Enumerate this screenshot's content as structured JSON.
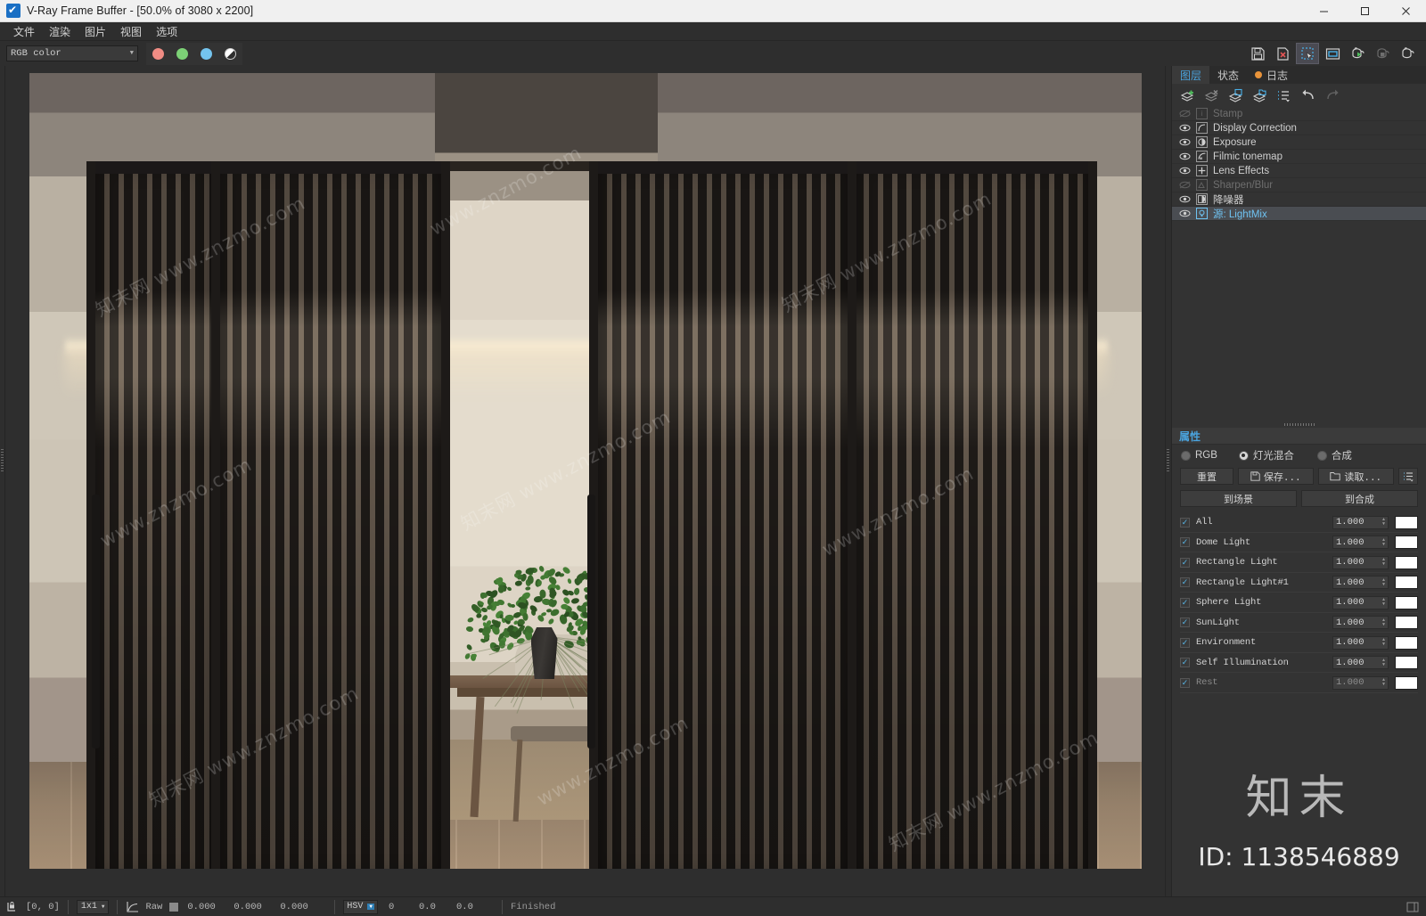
{
  "window": {
    "title": "V-Ray Frame Buffer - [50.0% of 3080 x 2200]",
    "minimize": "—",
    "maximize": "▢",
    "close": "✕"
  },
  "menubar": {
    "items": [
      "文件",
      "渲染",
      "图片",
      "视图",
      "选项"
    ]
  },
  "toolbar": {
    "channel_select": {
      "value": "RGB color",
      "caret": "▼"
    },
    "channels": [
      {
        "name": "red-channel-button",
        "color": "#f08c84"
      },
      {
        "name": "green-channel-button",
        "color": "#7cd176"
      },
      {
        "name": "blue-channel-button",
        "color": "#74c4ee"
      },
      {
        "name": "alpha-channel-button",
        "color": "#ffffff"
      }
    ],
    "right_buttons": [
      "save-image-icon",
      "save-raw-image-icon",
      "region-render-icon",
      "track-mouse-icon",
      "render-last-icon",
      "stop-render-icon",
      "render-icon"
    ]
  },
  "render_info": {
    "resolution": "3080 x 2200",
    "zoom": "50.0%"
  },
  "right_panel": {
    "tabs": [
      {
        "label": "图层",
        "active": true,
        "dot": false
      },
      {
        "label": "状态",
        "active": false,
        "dot": false
      },
      {
        "label": "日志",
        "active": false,
        "dot": true
      }
    ],
    "layer_toolbar": [
      "add-layer-icon",
      "delete-layer-icon",
      "save-layer-icon",
      "load-layer-icon",
      "layer-menu-icon",
      "undo-icon",
      "redo-icon"
    ],
    "layers": [
      {
        "label": "Stamp",
        "visible": false,
        "enabled": false,
        "selected": false,
        "icon": "stamp-icon"
      },
      {
        "label": "Display Correction",
        "visible": true,
        "enabled": true,
        "selected": false,
        "icon": "curve-icon"
      },
      {
        "label": "Exposure",
        "visible": true,
        "enabled": true,
        "selected": false,
        "icon": "exposure-icon"
      },
      {
        "label": "Filmic tonemap",
        "visible": true,
        "enabled": true,
        "selected": false,
        "icon": "tonemap-icon"
      },
      {
        "label": "Lens Effects",
        "visible": true,
        "enabled": true,
        "selected": false,
        "icon": "lens-icon"
      },
      {
        "label": "Sharpen/Blur",
        "visible": false,
        "enabled": false,
        "selected": false,
        "icon": "sharpen-icon"
      },
      {
        "label": "降噪器",
        "visible": true,
        "enabled": true,
        "selected": false,
        "icon": "denoiser-icon"
      },
      {
        "label": "源: LightMix",
        "visible": true,
        "enabled": true,
        "selected": true,
        "icon": "lightmix-icon"
      }
    ],
    "properties": {
      "title": "属性",
      "modes": [
        {
          "label": "RGB",
          "selected": false
        },
        {
          "label": "灯光混合",
          "selected": true
        },
        {
          "label": "合成",
          "selected": false
        }
      ],
      "actions": {
        "reset": "重置",
        "save": "保存...",
        "load": "读取...",
        "menu": "list-menu-icon"
      },
      "targets": {
        "to_scene": "到场景",
        "to_composite": "到合成"
      },
      "lights": [
        {
          "name": "All",
          "checked": true,
          "value": "1.000",
          "color": "#ffffff",
          "dim": false
        },
        {
          "name": "Dome Light",
          "checked": true,
          "value": "1.000",
          "color": "#ffffff",
          "dim": false
        },
        {
          "name": "Rectangle Light",
          "checked": true,
          "value": "1.000",
          "color": "#ffffff",
          "dim": false
        },
        {
          "name": "Rectangle Light#1",
          "checked": true,
          "value": "1.000",
          "color": "#ffffff",
          "dim": false
        },
        {
          "name": "Sphere Light",
          "checked": true,
          "value": "1.000",
          "color": "#ffffff",
          "dim": false
        },
        {
          "name": "SunLight",
          "checked": true,
          "value": "1.000",
          "color": "#ffffff",
          "dim": false
        },
        {
          "name": "Environment",
          "checked": true,
          "value": "1.000",
          "color": "#ffffff",
          "dim": false
        },
        {
          "name": "Self Illumination",
          "checked": true,
          "value": "1.000",
          "color": "#ffffff",
          "dim": false
        },
        {
          "name": "Rest",
          "checked": true,
          "value": "1.000",
          "color": "#ffffff",
          "dim": true
        }
      ]
    }
  },
  "statusbar": {
    "pixel_icon": "pixel-lock-icon",
    "coords": "[0,  0]",
    "sample_size": "1x1",
    "curve_icon": "curve-icon",
    "raw_label": "Raw",
    "color_values": [
      "0.000",
      "0.000",
      "0.000"
    ],
    "color_space": "HSV",
    "hsv_values": [
      "0",
      "0.0",
      "0.0"
    ],
    "status": "Finished"
  },
  "watermark": {
    "logo": "知末",
    "id": "ID: 1138546889",
    "tiles": [
      "知末网 www.znzmo.com",
      "www.znzmo.com",
      "知末网 www.znzmo.com"
    ]
  }
}
